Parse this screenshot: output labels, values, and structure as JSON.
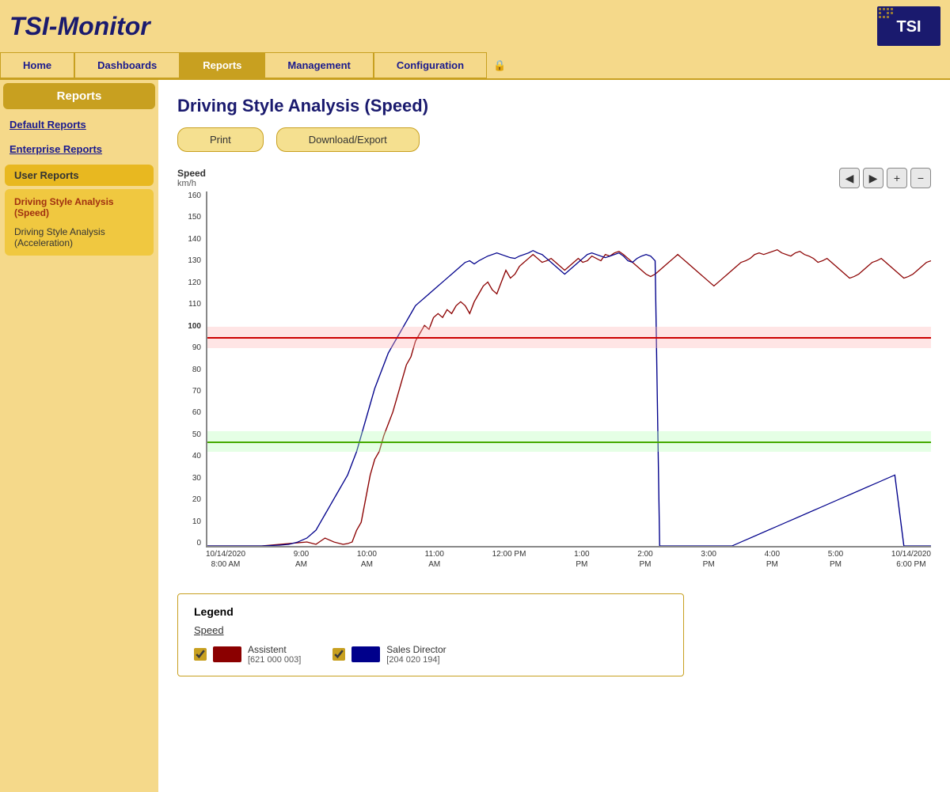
{
  "app": {
    "title": "TSI-Monitor"
  },
  "nav": {
    "items": [
      {
        "label": "Home",
        "active": false
      },
      {
        "label": "Dashboards",
        "active": false
      },
      {
        "label": "Reports",
        "active": true
      },
      {
        "label": "Management",
        "active": false
      },
      {
        "label": "Configuration",
        "active": false
      }
    ]
  },
  "sidebar": {
    "title": "Reports",
    "sections": [
      {
        "label": "Default Reports"
      },
      {
        "label": "Enterprise Reports"
      }
    ],
    "group": "User Reports",
    "items": [
      {
        "label": "Driving Style Analysis (Speed)",
        "active": true
      },
      {
        "label": "Driving Style Analysis (Acceleration)",
        "active": false
      }
    ]
  },
  "main": {
    "page_title": "Driving Style Analysis (Speed)",
    "toolbar": {
      "print_label": "Print",
      "download_label": "Download/Export"
    },
    "chart": {
      "y_axis_label": "Speed",
      "y_axis_unit": "km/h",
      "y_ticks": [
        "160",
        "150",
        "140",
        "130",
        "120",
        "110",
        "100",
        "90",
        "80",
        "70",
        "60",
        "50",
        "40",
        "30",
        "20",
        "10",
        "0"
      ],
      "x_labels": [
        {
          "text": "10/14/2020\n8:00 AM",
          "highlight": false
        },
        {
          "text": "9:00\nAM",
          "highlight": false
        },
        {
          "text": "10:00\nAM",
          "highlight": false
        },
        {
          "text": "11:00\nAM",
          "highlight": false
        },
        {
          "text": "12:00 PM",
          "highlight": false
        },
        {
          "text": "1:00\nPM",
          "highlight": false
        },
        {
          "text": "2:00\nPM",
          "highlight": false
        },
        {
          "text": "3:00\nPM",
          "highlight": false
        },
        {
          "text": "4:00\nPM",
          "highlight": false
        },
        {
          "text": "5:00\nPM",
          "highlight": false
        },
        {
          "text": "10/14/2020\n6:00 PM",
          "highlight": false
        }
      ],
      "ref_line_red": 100,
      "ref_line_green": 50
    },
    "legend": {
      "title": "Legend",
      "section": "Speed",
      "items": [
        {
          "label": "Assistent",
          "sub": "[621 000 003]",
          "color": "#8B0000"
        },
        {
          "label": "Sales Director",
          "sub": "[204 020 194]",
          "color": "#00008B"
        }
      ]
    }
  }
}
